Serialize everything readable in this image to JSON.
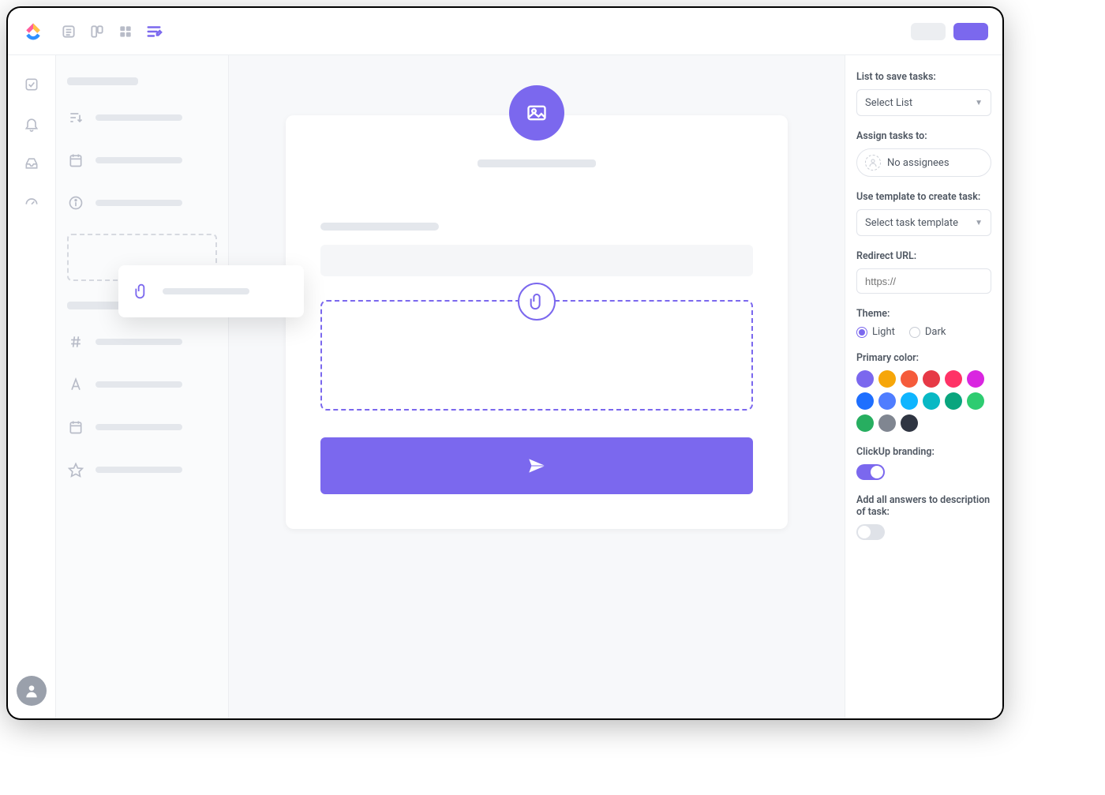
{
  "topbar": {
    "views": [
      "list",
      "board",
      "grid",
      "form"
    ],
    "active_view": "form"
  },
  "rail": {
    "items": [
      "check-square",
      "bell",
      "inbox",
      "gauge"
    ]
  },
  "sidebar": {
    "section1": [
      {
        "icon": "sort"
      },
      {
        "icon": "calendar"
      },
      {
        "icon": "info"
      }
    ],
    "section2": [
      {
        "icon": "hash"
      },
      {
        "icon": "font"
      },
      {
        "icon": "calendar"
      },
      {
        "icon": "star"
      }
    ]
  },
  "floating_item": {
    "icon": "attachment"
  },
  "form": {
    "hero_icon": "image",
    "attach_icon": "attachment",
    "submit_icon": "send"
  },
  "settings": {
    "list_label": "List to save tasks:",
    "list_value": "Select List",
    "assign_label": "Assign tasks to:",
    "assign_value": "No assignees",
    "template_label": "Use template to create task:",
    "template_value": "Select task template",
    "redirect_label": "Redirect URL:",
    "redirect_placeholder": "https://",
    "theme_label": "Theme:",
    "theme_light": "Light",
    "theme_dark": "Dark",
    "theme_selected": "light",
    "primary_label": "Primary color:",
    "colors": [
      "#7b68ee",
      "#f6a609",
      "#f55b3b",
      "#e63946",
      "#ff3366",
      "#d926e0",
      "#1e6fff",
      "#4f7dff",
      "#0fb5ff",
      "#08b8c4",
      "#0aa57e",
      "#2ecc71",
      "#27ae60",
      "#808691",
      "#2f3542"
    ],
    "branding_label": "ClickUp branding:",
    "branding_on": true,
    "answers_label": "Add all answers to description of task:",
    "answers_on": false
  }
}
